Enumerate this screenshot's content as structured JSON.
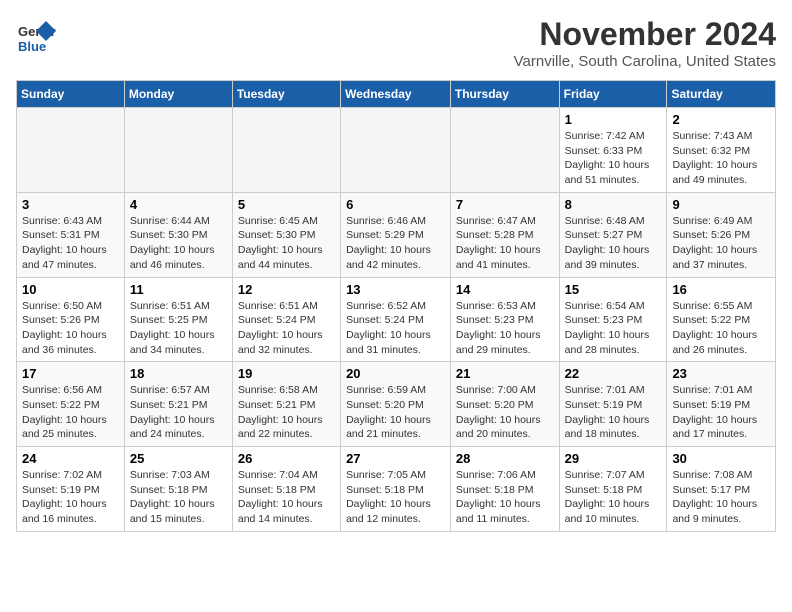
{
  "logo": {
    "general": "General",
    "blue": "Blue"
  },
  "title": "November 2024",
  "location": "Varnville, South Carolina, United States",
  "weekdays": [
    "Sunday",
    "Monday",
    "Tuesday",
    "Wednesday",
    "Thursday",
    "Friday",
    "Saturday"
  ],
  "weeks": [
    [
      {
        "day": "",
        "empty": true
      },
      {
        "day": "",
        "empty": true
      },
      {
        "day": "",
        "empty": true
      },
      {
        "day": "",
        "empty": true
      },
      {
        "day": "",
        "empty": true
      },
      {
        "day": "1",
        "sunrise": "Sunrise: 7:42 AM",
        "sunset": "Sunset: 6:33 PM",
        "daylight": "Daylight: 10 hours and 51 minutes."
      },
      {
        "day": "2",
        "sunrise": "Sunrise: 7:43 AM",
        "sunset": "Sunset: 6:32 PM",
        "daylight": "Daylight: 10 hours and 49 minutes."
      }
    ],
    [
      {
        "day": "3",
        "sunrise": "Sunrise: 6:43 AM",
        "sunset": "Sunset: 5:31 PM",
        "daylight": "Daylight: 10 hours and 47 minutes."
      },
      {
        "day": "4",
        "sunrise": "Sunrise: 6:44 AM",
        "sunset": "Sunset: 5:30 PM",
        "daylight": "Daylight: 10 hours and 46 minutes."
      },
      {
        "day": "5",
        "sunrise": "Sunrise: 6:45 AM",
        "sunset": "Sunset: 5:30 PM",
        "daylight": "Daylight: 10 hours and 44 minutes."
      },
      {
        "day": "6",
        "sunrise": "Sunrise: 6:46 AM",
        "sunset": "Sunset: 5:29 PM",
        "daylight": "Daylight: 10 hours and 42 minutes."
      },
      {
        "day": "7",
        "sunrise": "Sunrise: 6:47 AM",
        "sunset": "Sunset: 5:28 PM",
        "daylight": "Daylight: 10 hours and 41 minutes."
      },
      {
        "day": "8",
        "sunrise": "Sunrise: 6:48 AM",
        "sunset": "Sunset: 5:27 PM",
        "daylight": "Daylight: 10 hours and 39 minutes."
      },
      {
        "day": "9",
        "sunrise": "Sunrise: 6:49 AM",
        "sunset": "Sunset: 5:26 PM",
        "daylight": "Daylight: 10 hours and 37 minutes."
      }
    ],
    [
      {
        "day": "10",
        "sunrise": "Sunrise: 6:50 AM",
        "sunset": "Sunset: 5:26 PM",
        "daylight": "Daylight: 10 hours and 36 minutes."
      },
      {
        "day": "11",
        "sunrise": "Sunrise: 6:51 AM",
        "sunset": "Sunset: 5:25 PM",
        "daylight": "Daylight: 10 hours and 34 minutes."
      },
      {
        "day": "12",
        "sunrise": "Sunrise: 6:51 AM",
        "sunset": "Sunset: 5:24 PM",
        "daylight": "Daylight: 10 hours and 32 minutes."
      },
      {
        "day": "13",
        "sunrise": "Sunrise: 6:52 AM",
        "sunset": "Sunset: 5:24 PM",
        "daylight": "Daylight: 10 hours and 31 minutes."
      },
      {
        "day": "14",
        "sunrise": "Sunrise: 6:53 AM",
        "sunset": "Sunset: 5:23 PM",
        "daylight": "Daylight: 10 hours and 29 minutes."
      },
      {
        "day": "15",
        "sunrise": "Sunrise: 6:54 AM",
        "sunset": "Sunset: 5:23 PM",
        "daylight": "Daylight: 10 hours and 28 minutes."
      },
      {
        "day": "16",
        "sunrise": "Sunrise: 6:55 AM",
        "sunset": "Sunset: 5:22 PM",
        "daylight": "Daylight: 10 hours and 26 minutes."
      }
    ],
    [
      {
        "day": "17",
        "sunrise": "Sunrise: 6:56 AM",
        "sunset": "Sunset: 5:22 PM",
        "daylight": "Daylight: 10 hours and 25 minutes."
      },
      {
        "day": "18",
        "sunrise": "Sunrise: 6:57 AM",
        "sunset": "Sunset: 5:21 PM",
        "daylight": "Daylight: 10 hours and 24 minutes."
      },
      {
        "day": "19",
        "sunrise": "Sunrise: 6:58 AM",
        "sunset": "Sunset: 5:21 PM",
        "daylight": "Daylight: 10 hours and 22 minutes."
      },
      {
        "day": "20",
        "sunrise": "Sunrise: 6:59 AM",
        "sunset": "Sunset: 5:20 PM",
        "daylight": "Daylight: 10 hours and 21 minutes."
      },
      {
        "day": "21",
        "sunrise": "Sunrise: 7:00 AM",
        "sunset": "Sunset: 5:20 PM",
        "daylight": "Daylight: 10 hours and 20 minutes."
      },
      {
        "day": "22",
        "sunrise": "Sunrise: 7:01 AM",
        "sunset": "Sunset: 5:19 PM",
        "daylight": "Daylight: 10 hours and 18 minutes."
      },
      {
        "day": "23",
        "sunrise": "Sunrise: 7:01 AM",
        "sunset": "Sunset: 5:19 PM",
        "daylight": "Daylight: 10 hours and 17 minutes."
      }
    ],
    [
      {
        "day": "24",
        "sunrise": "Sunrise: 7:02 AM",
        "sunset": "Sunset: 5:19 PM",
        "daylight": "Daylight: 10 hours and 16 minutes."
      },
      {
        "day": "25",
        "sunrise": "Sunrise: 7:03 AM",
        "sunset": "Sunset: 5:18 PM",
        "daylight": "Daylight: 10 hours and 15 minutes."
      },
      {
        "day": "26",
        "sunrise": "Sunrise: 7:04 AM",
        "sunset": "Sunset: 5:18 PM",
        "daylight": "Daylight: 10 hours and 14 minutes."
      },
      {
        "day": "27",
        "sunrise": "Sunrise: 7:05 AM",
        "sunset": "Sunset: 5:18 PM",
        "daylight": "Daylight: 10 hours and 12 minutes."
      },
      {
        "day": "28",
        "sunrise": "Sunrise: 7:06 AM",
        "sunset": "Sunset: 5:18 PM",
        "daylight": "Daylight: 10 hours and 11 minutes."
      },
      {
        "day": "29",
        "sunrise": "Sunrise: 7:07 AM",
        "sunset": "Sunset: 5:18 PM",
        "daylight": "Daylight: 10 hours and 10 minutes."
      },
      {
        "day": "30",
        "sunrise": "Sunrise: 7:08 AM",
        "sunset": "Sunset: 5:17 PM",
        "daylight": "Daylight: 10 hours and 9 minutes."
      }
    ]
  ]
}
